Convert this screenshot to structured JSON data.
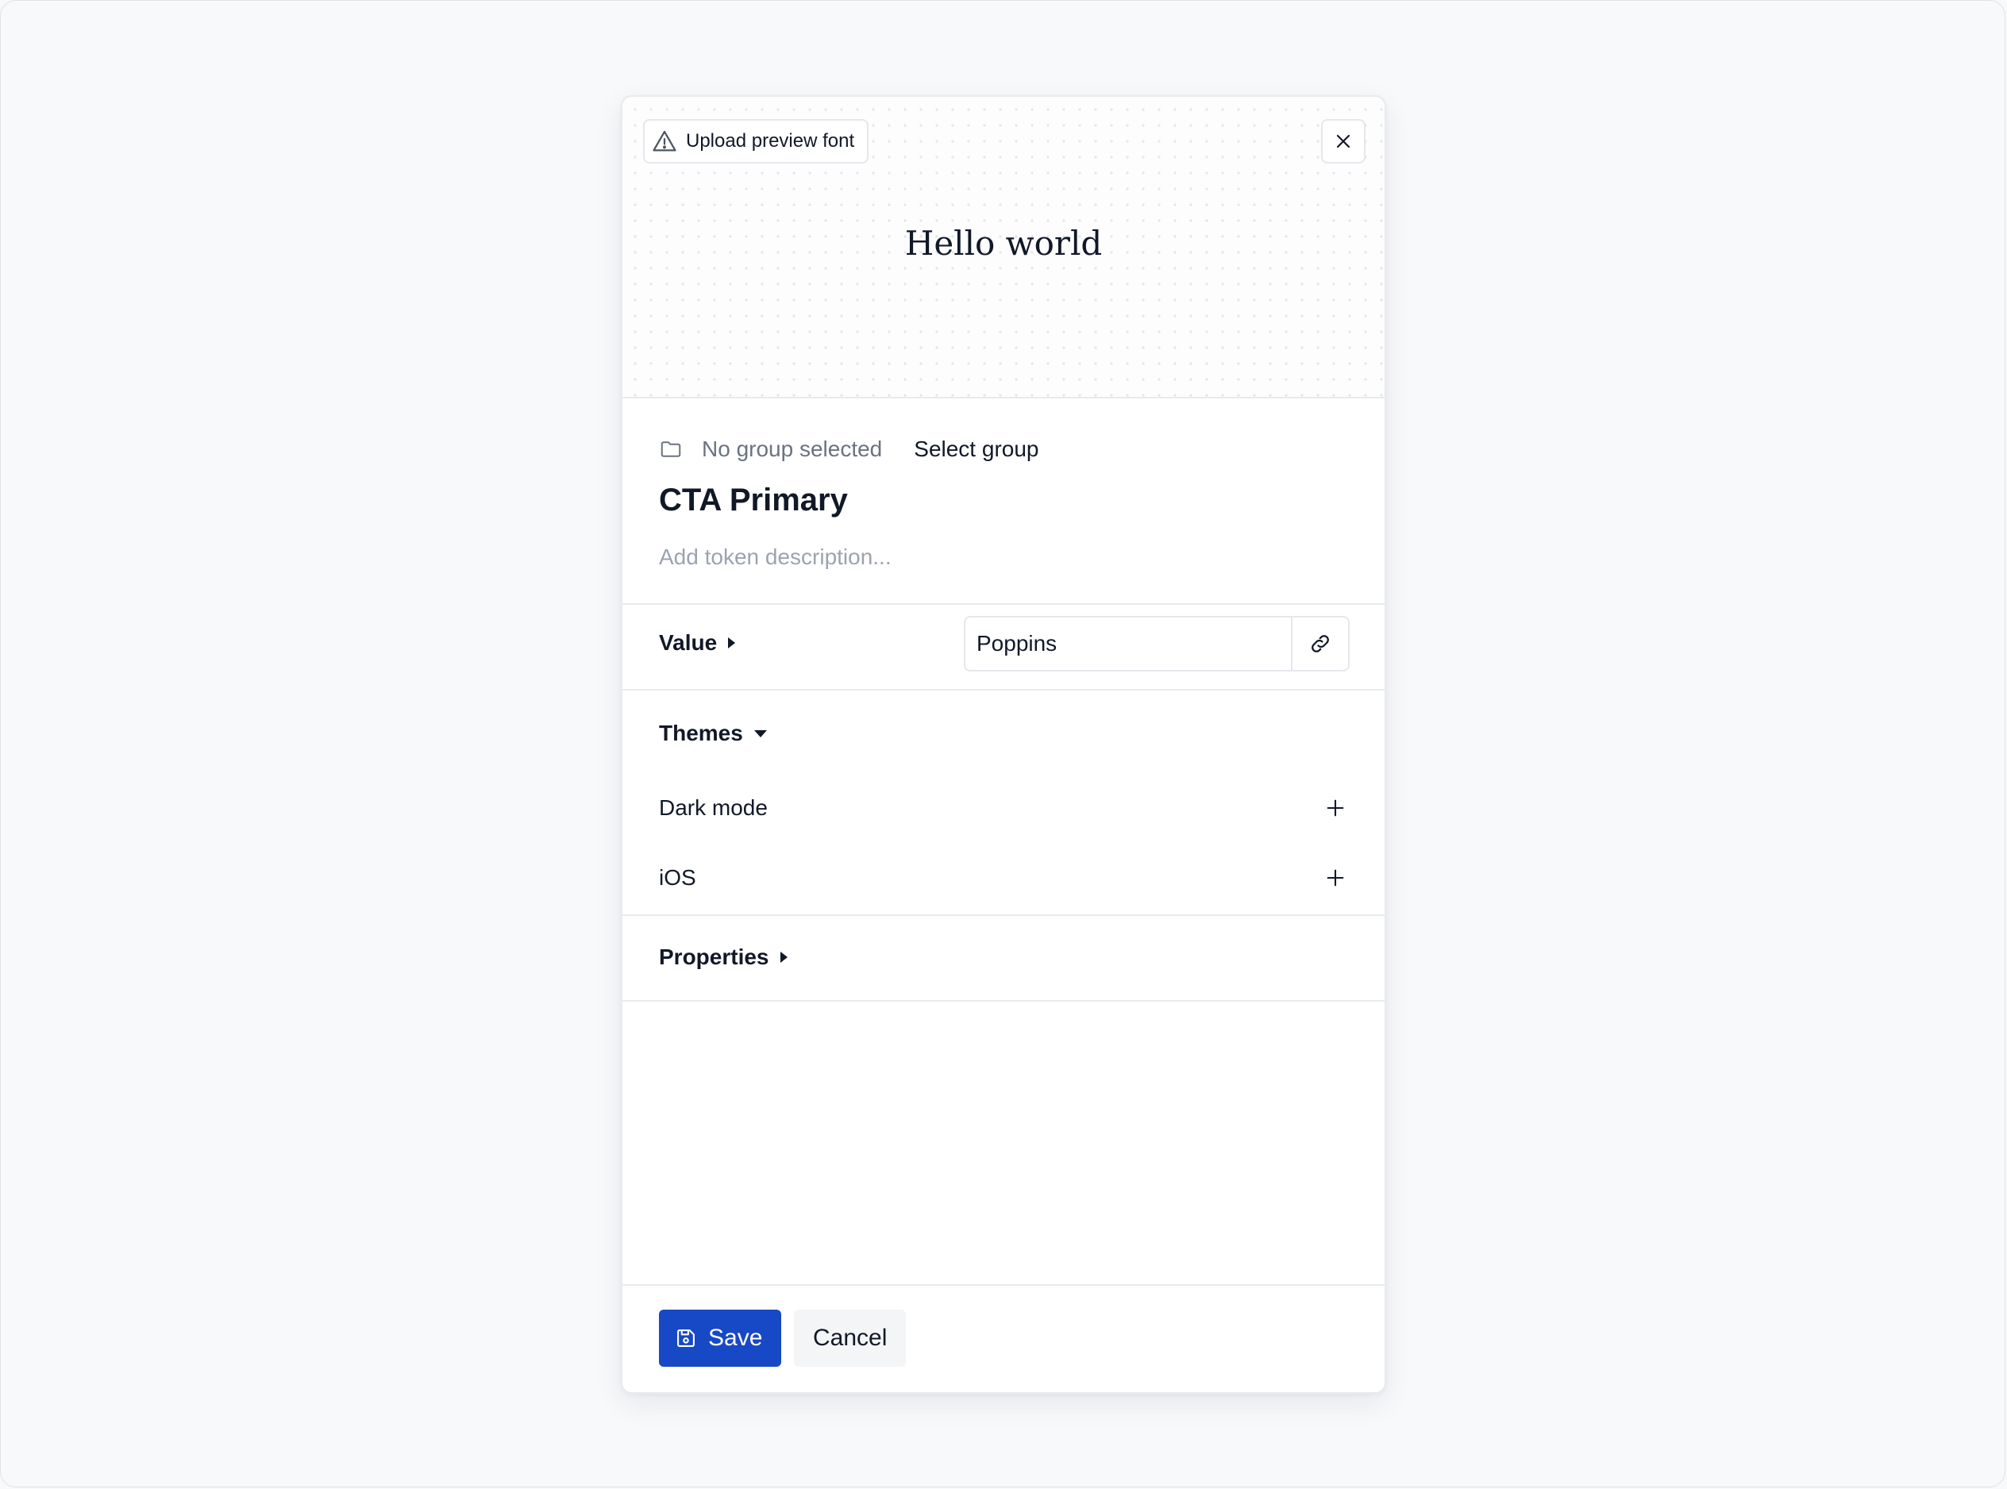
{
  "preview": {
    "upload_label": "Upload preview font",
    "sample_text": "Hello world"
  },
  "token": {
    "group_status": "No group selected",
    "select_group_label": "Select group",
    "name": "CTA Primary",
    "description_placeholder": "Add token description..."
  },
  "value_section": {
    "title": "Value",
    "value": "Poppins"
  },
  "themes_section": {
    "title": "Themes",
    "items": [
      {
        "label": "Dark mode"
      },
      {
        "label": "iOS"
      }
    ]
  },
  "properties_section": {
    "title": "Properties"
  },
  "footer": {
    "save_label": "Save",
    "cancel_label": "Cancel"
  },
  "colors": {
    "primary": "#1748c6",
    "muted_text": "#6b7280",
    "placeholder_text": "#9ca3af",
    "border": "#e8eaee"
  },
  "icons": {
    "upload": "warning-triangle-icon",
    "close": "close-icon",
    "group": "folder-icon",
    "alias": "link-icon",
    "theme_add": "plus-icon",
    "save": "floppy-disk-icon"
  }
}
